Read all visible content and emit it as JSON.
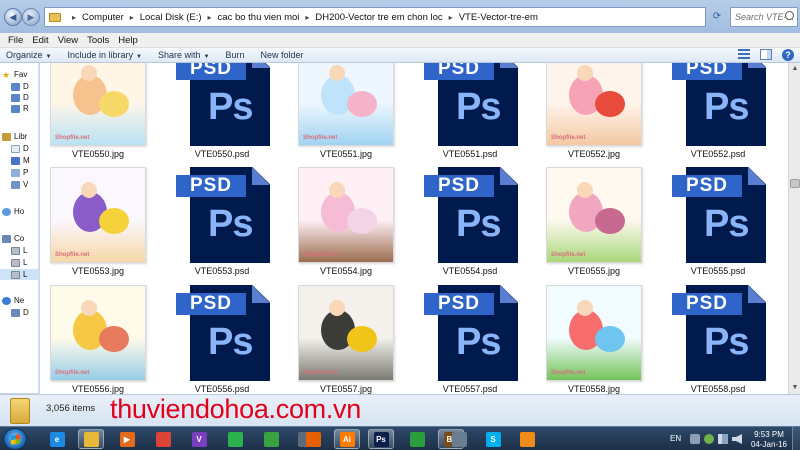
{
  "window": {
    "breadcrumbs": [
      "Computer",
      "Local Disk (E:)",
      "cac bo thu vien moi",
      "DH200-Vector tre em chon loc",
      "VTE-Vector-tre-em"
    ],
    "search_placeholder": "Search VTE-..."
  },
  "menu": [
    "File",
    "Edit",
    "View",
    "Tools",
    "Help"
  ],
  "toolbar": {
    "organize": "Organize",
    "include_in_library": "Include in library",
    "share_with": "Share with",
    "burn": "Burn",
    "new_folder": "New folder"
  },
  "nav_pane": {
    "items": [
      {
        "label": "Fav",
        "icon": "star-icon"
      },
      {
        "label": "D",
        "icon": "desktop-icon"
      },
      {
        "label": "D",
        "icon": "downloads-icon"
      },
      {
        "label": "R",
        "icon": "recent-places-icon"
      },
      {
        "label": "Libr",
        "icon": "libraries-icon"
      },
      {
        "label": "D",
        "icon": "documents-icon"
      },
      {
        "label": "M",
        "icon": "music-icon"
      },
      {
        "label": "P",
        "icon": "pictures-icon"
      },
      {
        "label": "V",
        "icon": "videos-icon"
      },
      {
        "label": "Ho",
        "icon": "homegroup-icon"
      },
      {
        "label": "Co",
        "icon": "computer-icon"
      },
      {
        "label": "L",
        "icon": "local-disk-icon"
      },
      {
        "label": "L",
        "icon": "local-disk-icon"
      },
      {
        "label": "L",
        "icon": "local-disk-icon"
      },
      {
        "label": "Ne",
        "icon": "network-icon"
      },
      {
        "label": "D",
        "icon": "network-computer-icon"
      }
    ]
  },
  "files": [
    {
      "name": "VTE0550.jpg",
      "type": "jpg"
    },
    {
      "name": "VTE0550.psd",
      "type": "psd"
    },
    {
      "name": "VTE0551.jpg",
      "type": "jpg"
    },
    {
      "name": "VTE0551.psd",
      "type": "psd"
    },
    {
      "name": "VTE0552.jpg",
      "type": "jpg"
    },
    {
      "name": "VTE0552.psd",
      "type": "psd"
    },
    {
      "name": "VTE0553.jpg",
      "type": "jpg"
    },
    {
      "name": "VTE0553.psd",
      "type": "psd"
    },
    {
      "name": "VTE0554.jpg",
      "type": "jpg"
    },
    {
      "name": "VTE0554.psd",
      "type": "psd"
    },
    {
      "name": "VTE0555.jpg",
      "type": "jpg"
    },
    {
      "name": "VTE0555.psd",
      "type": "psd"
    },
    {
      "name": "VTE0556.jpg",
      "type": "jpg"
    },
    {
      "name": "VTE0556.psd",
      "type": "psd"
    },
    {
      "name": "VTE0557.jpg",
      "type": "jpg"
    },
    {
      "name": "VTE0557.psd",
      "type": "psd"
    },
    {
      "name": "VTE0558.jpg",
      "type": "jpg"
    },
    {
      "name": "VTE0558.psd",
      "type": "psd"
    }
  ],
  "thumb_watermark": "Shopfile.net",
  "psd_icon": {
    "tag": "PSD",
    "glyph": "Ps"
  },
  "details": {
    "item_count": "3,056 items",
    "watermark": "thuviendohoa.com.vn"
  },
  "taskbar": {
    "apps": [
      {
        "name": "internet-explorer-icon",
        "glyph": "e",
        "color": "#1e88e5"
      },
      {
        "name": "windows-explorer-icon",
        "glyph": "",
        "color": "#e7b93a",
        "active": true
      },
      {
        "name": "media-player-icon",
        "glyph": "▶",
        "color": "#e46a1a"
      },
      {
        "name": "chrome-icon",
        "glyph": "",
        "color": "#db4437"
      },
      {
        "name": "unikey-icon",
        "glyph": "V",
        "color": "#7a3fbf"
      },
      {
        "name": "feedly-icon",
        "glyph": "",
        "color": "#2bb24c"
      },
      {
        "name": "green-app-icon",
        "glyph": "",
        "color": "#3aa341"
      },
      {
        "name": "tools-icon",
        "glyph": "",
        "color": "#5d6b7c"
      },
      {
        "name": "firefox-icon",
        "glyph": "",
        "color": "#e66000"
      },
      {
        "name": "illustrator-icon",
        "glyph": "Ai",
        "color": "#ff7c00",
        "active": true
      },
      {
        "name": "photoshop-icon",
        "glyph": "Ps",
        "color": "#0b1f4a",
        "active": true
      },
      {
        "name": "corel-icon",
        "glyph": "",
        "color": "#2a9d3e"
      },
      {
        "name": "bridge-icon",
        "glyph": "Br",
        "color": "#7a4b1c",
        "active": true
      },
      {
        "name": "folder-icon",
        "glyph": "",
        "color": "#6a7d93"
      },
      {
        "name": "skype-icon",
        "glyph": "S",
        "color": "#00aff0"
      },
      {
        "name": "app-icon",
        "glyph": "",
        "color": "#f08c1a"
      }
    ],
    "language": "EN",
    "time": "9:53 PM",
    "date": "04-Jan-16"
  }
}
